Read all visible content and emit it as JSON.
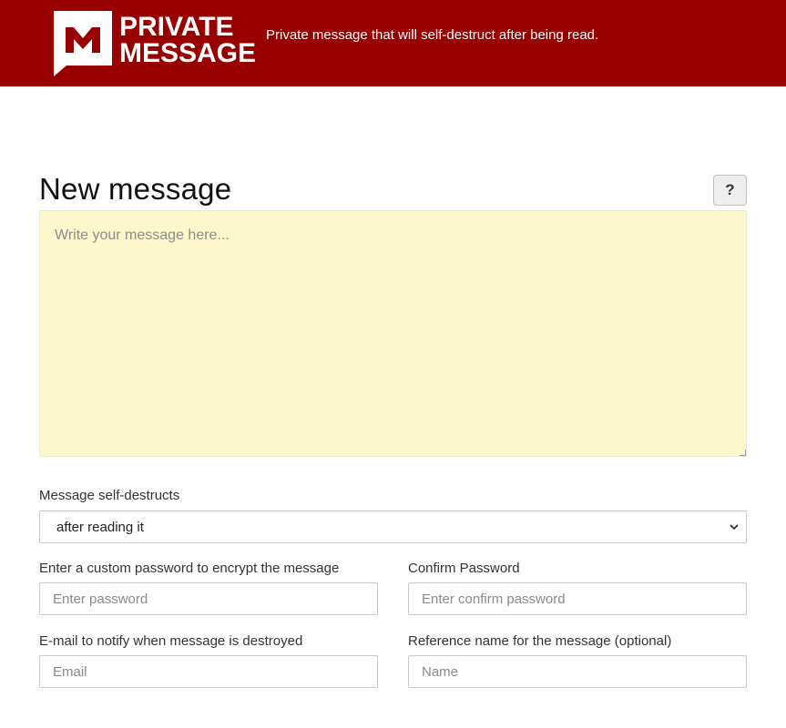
{
  "header": {
    "logo_line1": "PRIVATE",
    "logo_line2": "MESSAGE",
    "tagline": "Private message that will self-destruct after being read.",
    "brand_color": "#980000"
  },
  "main": {
    "title": "New message",
    "help_label": "?",
    "message_placeholder": "Write your message here..."
  },
  "form": {
    "self_destruct": {
      "label": "Message self-destructs",
      "selected": "after reading it"
    },
    "password": {
      "label": "Enter a custom password to encrypt the message",
      "placeholder": "Enter password"
    },
    "confirm_password": {
      "label": "Confirm Password",
      "placeholder": "Enter confirm password"
    },
    "email": {
      "label": "E-mail to notify when message is destroyed",
      "placeholder": "Email"
    },
    "reference": {
      "label": "Reference name for the message (optional)",
      "placeholder": "Name"
    }
  },
  "colors": {
    "message_bg": "#fdf7cc",
    "header_bg": "#980000"
  }
}
